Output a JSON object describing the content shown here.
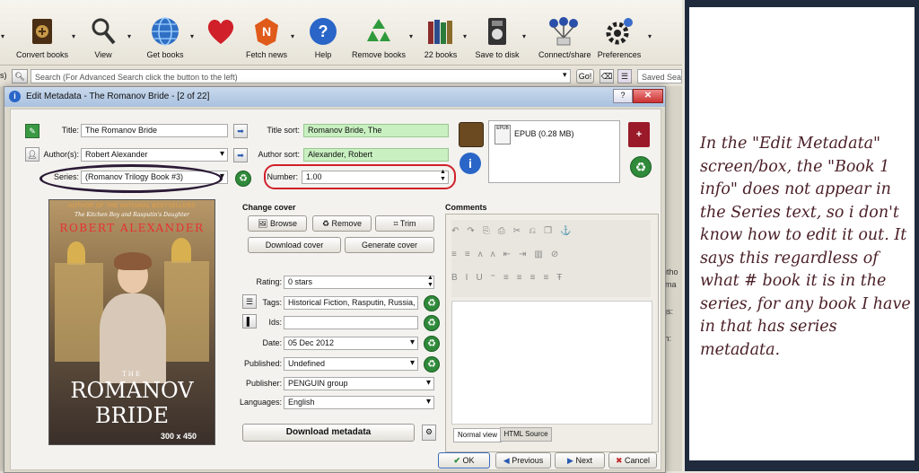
{
  "toolbar": {
    "items": [
      {
        "label": "Convert books",
        "icon": "convert-books-icon"
      },
      {
        "label": "View",
        "icon": "view-magnifier-icon"
      },
      {
        "label": "Get books",
        "icon": "get-books-globe-icon"
      },
      {
        "label": "",
        "icon": "heart-icon"
      },
      {
        "label": "Fetch news",
        "icon": "fetch-news-icon"
      },
      {
        "label": "Help",
        "icon": "help-icon"
      },
      {
        "label": "Remove books",
        "icon": "recycle-icon"
      },
      {
        "label": "22 books",
        "icon": "library-books-icon"
      },
      {
        "label": "Save to disk",
        "icon": "save-disk-icon"
      },
      {
        "label": "Connect/share",
        "icon": "connect-share-icon"
      },
      {
        "label": "Preferences",
        "icon": "preferences-gear-icon"
      }
    ]
  },
  "search": {
    "left_text": "s)",
    "placeholder": "Search (For Advanced Search click the button to the left)",
    "go_label": "Go!",
    "saved_placeholder": "Saved Search"
  },
  "dialog": {
    "title": "Edit Metadata - The Romanov Bride  - [2 of 22]",
    "fields": {
      "title_label": "Title:",
      "title_value": "The Romanov Bride",
      "title_sort_label": "Title sort:",
      "title_sort_value": "Romanov Bride, The",
      "authors_label": "Author(s):",
      "authors_value": "Robert Alexander",
      "author_sort_label": "Author sort:",
      "author_sort_value": "Alexander, Robert",
      "series_label": "Series:",
      "series_value": "(Romanov Trilogy Book #3)",
      "number_label": "Number:",
      "number_value": "1.00"
    },
    "format": {
      "name": "EPUB (0.28 MB)",
      "badge": "EPUB"
    },
    "cover": {
      "header": "AUTHOR OF THE NATIONAL BESTSELLERS",
      "sub": "The Kitchen Boy and Rasputin's Daughter",
      "author": "ROBERT ALEXANDER",
      "the": "THE",
      "title1": "ROMANOV",
      "title2": "BRIDE",
      "size": "300 x 450"
    },
    "change_cover": {
      "heading": "Change cover",
      "browse": "Browse",
      "remove": "Remove",
      "trim": "Trim",
      "download": "Download cover",
      "generate": "Generate cover"
    },
    "meta": {
      "rating_label": "Rating:",
      "rating_value": "0 stars",
      "tags_label": "Tags:",
      "tags_value": "Historical Fiction, Rasputin, Russia, Ro",
      "ids_label": "Ids:",
      "ids_value": "",
      "date_label": "Date:",
      "date_value": "05 Dec 2012",
      "published_label": "Published:",
      "published_value": "Undefined",
      "publisher_label": "Publisher:",
      "publisher_value": "PENGUIN group",
      "languages_label": "Languages:",
      "languages_value": "English"
    },
    "download_metadata": "Download metadata",
    "comments": {
      "label": "Comments",
      "tab_normal": "Normal view",
      "tab_html": "HTML Source"
    },
    "buttons": {
      "ok": "OK",
      "previous": "Previous",
      "next": "Next",
      "cancel": "Cancel"
    }
  },
  "bg_sidebar": [
    "utho",
    "rma",
    "gs:",
    "th:"
  ],
  "note": {
    "text": "In the \"Edit Metadata\" screen/box, the \"Book 1 info\" does not appear in the Series text, so i don't know how to edit it out. It says this regardless of what # book it is in the series, for any book I have in that has series metadata."
  },
  "colors": {
    "annotation_dark": "#2b1a36",
    "annotation_red": "#d0202a",
    "note_text": "#4a1f27"
  }
}
